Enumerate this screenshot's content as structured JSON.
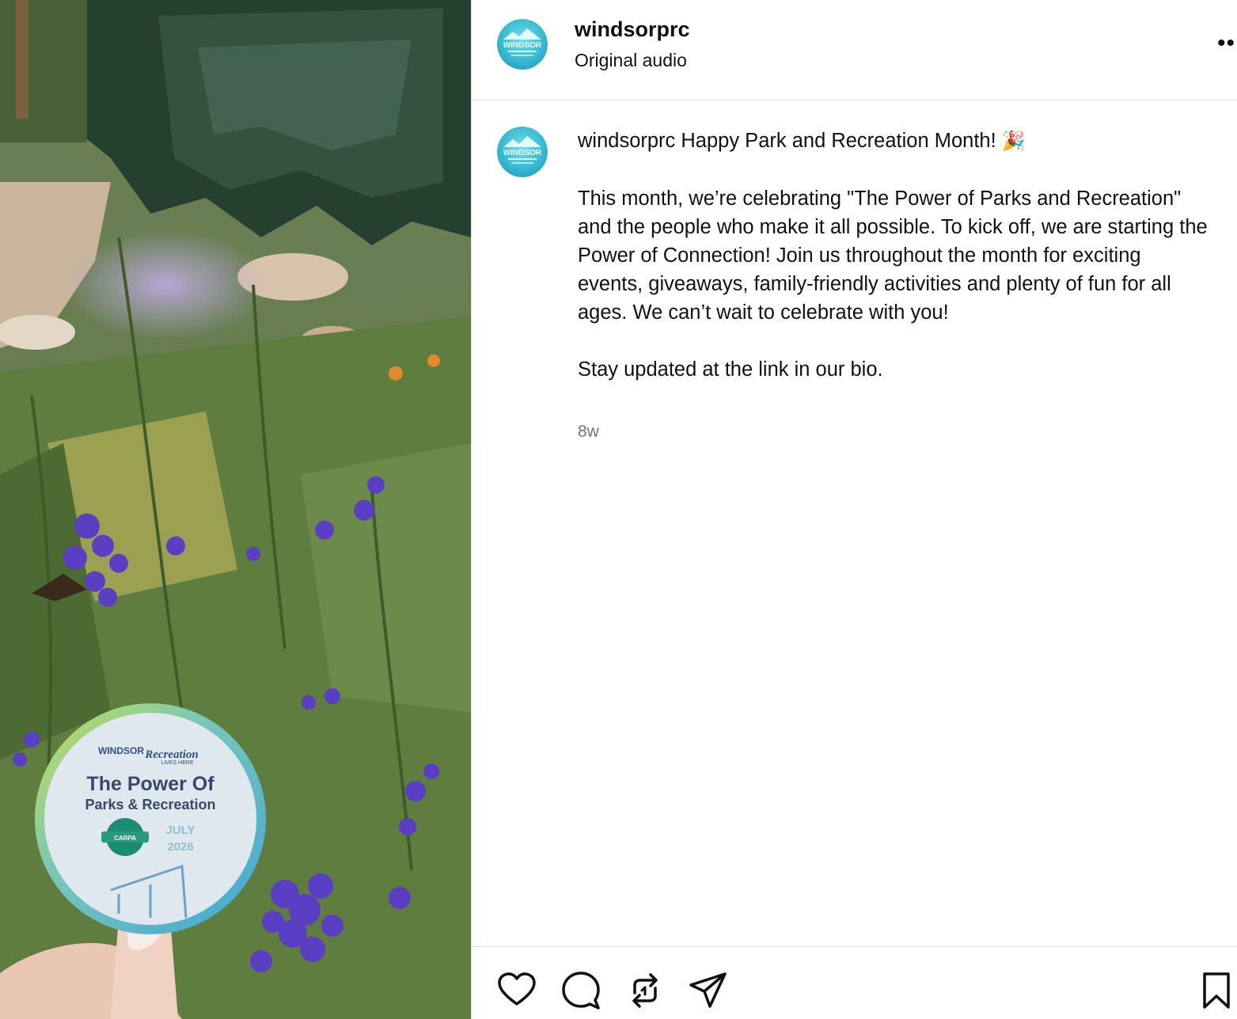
{
  "post": {
    "username": "windsorprc",
    "audio_label": "Original audio",
    "more_label": "••",
    "avatar_text": "WINDSOR"
  },
  "caption": {
    "username": "windsorprc",
    "first_line": "Happy Park and Recreation Month!",
    "emoji": "🎉",
    "paragraph": "This month, we’re celebrating \"The Power of Parks and Recreation\" and the people who make it all possible. To kick off, we are starting the Power of Connection! Join us throughout the month for exciting events, giveaways, family-friendly activities and plenty of fun for all ages. We can’t wait to celebrate with you!",
    "closing": "Stay updated at the link in our bio.",
    "age": "8w"
  },
  "media": {
    "badge": {
      "brand_top": "WINDSOR",
      "brand_right": "Recreation",
      "brand_right_sub": "LIVES HERE",
      "title": "The Power Of",
      "subtitle": "Parks & Recreation",
      "emblem": "CARPA",
      "month": "JULY",
      "year": "2026"
    }
  },
  "actions": {
    "like": "heart-icon",
    "comment": "comment-icon",
    "repost": "repost-icon",
    "share": "share-icon",
    "save": "bookmark-icon"
  },
  "colors": {
    "text": "#111111",
    "muted": "#737373",
    "divider": "#e2e2e2",
    "avatar_accent": "#3cc6d8"
  }
}
